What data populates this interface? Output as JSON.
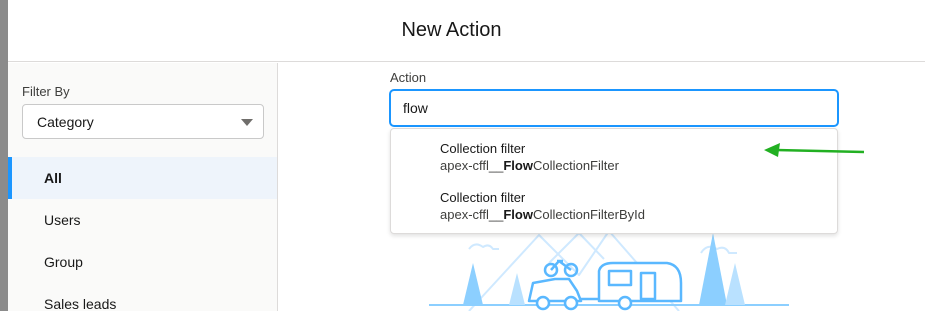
{
  "modal": {
    "title": "New Action"
  },
  "sidebar": {
    "filter_label": "Filter By",
    "filter_value": "Category",
    "items": [
      {
        "label": "All",
        "active": true
      },
      {
        "label": "Users",
        "active": false
      },
      {
        "label": "Group",
        "active": false
      },
      {
        "label": "Sales leads",
        "active": false
      }
    ]
  },
  "main": {
    "action_label": "Action",
    "search_value": "flow"
  },
  "dropdown": {
    "options": [
      {
        "title": "Collection filter",
        "api_prefix": "apex-cffl__",
        "api_match": "Flow",
        "api_suffix": "CollectionFilter"
      },
      {
        "title": "Collection filter",
        "api_prefix": "apex-cffl__",
        "api_match": "Flow",
        "api_suffix": "CollectionFilterById"
      }
    ]
  },
  "colors": {
    "accent": "#1b96ff",
    "active_bg": "#eef4fb",
    "annotation_arrow": "#22b022",
    "illustration": "#8ccfff"
  }
}
